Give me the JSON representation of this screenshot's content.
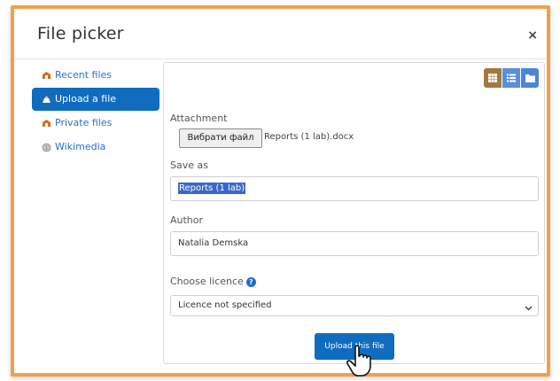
{
  "dialog": {
    "title": "File picker",
    "close_symbol": "×"
  },
  "sidebar": {
    "items": [
      {
        "label": "Recent files",
        "icon": "recent-files-icon",
        "active": false
      },
      {
        "label": "Upload a file",
        "icon": "upload-icon",
        "active": true
      },
      {
        "label": "Private files",
        "icon": "private-files-icon",
        "active": false
      },
      {
        "label": "Wikimedia",
        "icon": "wikimedia-icon",
        "active": false
      }
    ]
  },
  "view_buttons": [
    {
      "name": "grid-view-icon",
      "active": true
    },
    {
      "name": "list-view-icon",
      "active": false
    },
    {
      "name": "tree-view-icon",
      "active": false
    }
  ],
  "form": {
    "attachment_label": "Attachment",
    "choose_file_button": "Вибрати файл",
    "file_name": "Reports (1 lab).docx",
    "save_as_label": "Save as",
    "save_as_value": "Reports (1 lab)",
    "author_label": "Author",
    "author_value": "Natalia Demska",
    "licence_label": "Choose licence",
    "licence_value": "Licence not specified",
    "upload_button": "Upload this file"
  },
  "colors": {
    "frame_border": "#f0a04b",
    "primary": "#0f6cbf",
    "link": "#2a6fcf"
  }
}
